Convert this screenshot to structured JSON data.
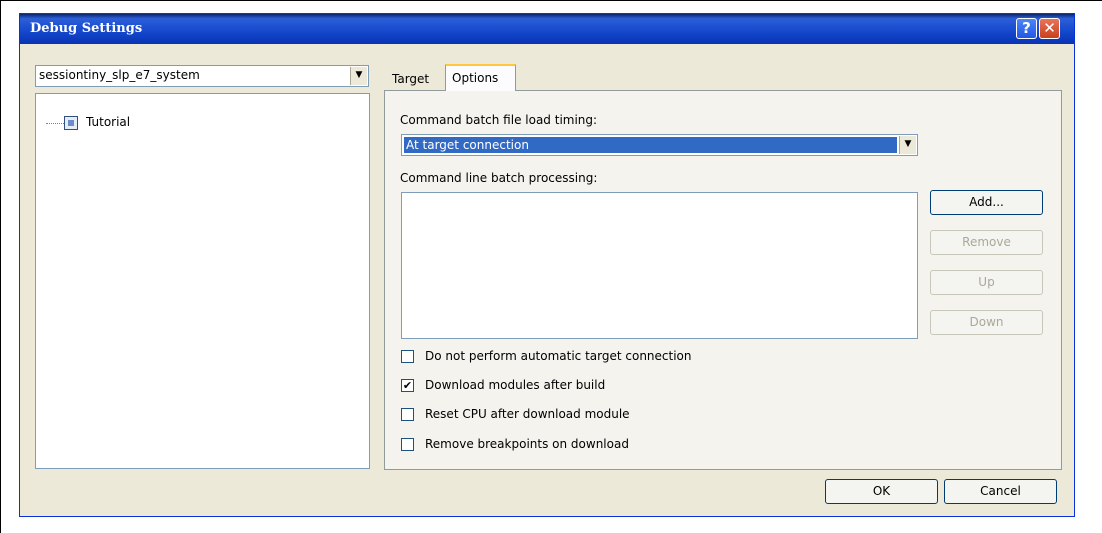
{
  "window": {
    "title": "Debug Settings",
    "help_glyph": "?",
    "close_glyph": "✕"
  },
  "session": {
    "selected": "sessiontiny_slp_e7_system"
  },
  "tree": {
    "items": [
      {
        "label": "Tutorial"
      }
    ]
  },
  "tabs": [
    {
      "label": "Target",
      "active": false
    },
    {
      "label": "Options",
      "active": true
    }
  ],
  "options": {
    "timing_label": "Command batch file load timing:",
    "timing_value": "At target connection",
    "cmdline_label": "Command line batch processing:",
    "buttons": {
      "add": "Add...",
      "remove": "Remove",
      "up": "Up",
      "down": "Down"
    },
    "checkboxes": [
      {
        "label": "Do not perform automatic target connection",
        "checked": false
      },
      {
        "label": "Download modules after build",
        "checked": true
      },
      {
        "label": "Reset CPU after download module",
        "checked": false
      },
      {
        "label": "Remove breakpoints on download",
        "checked": false
      }
    ]
  },
  "footer": {
    "ok": "OK",
    "cancel": "Cancel"
  },
  "glyphs": {
    "dropdown_arrow": "▼",
    "check_mark": "✔"
  }
}
